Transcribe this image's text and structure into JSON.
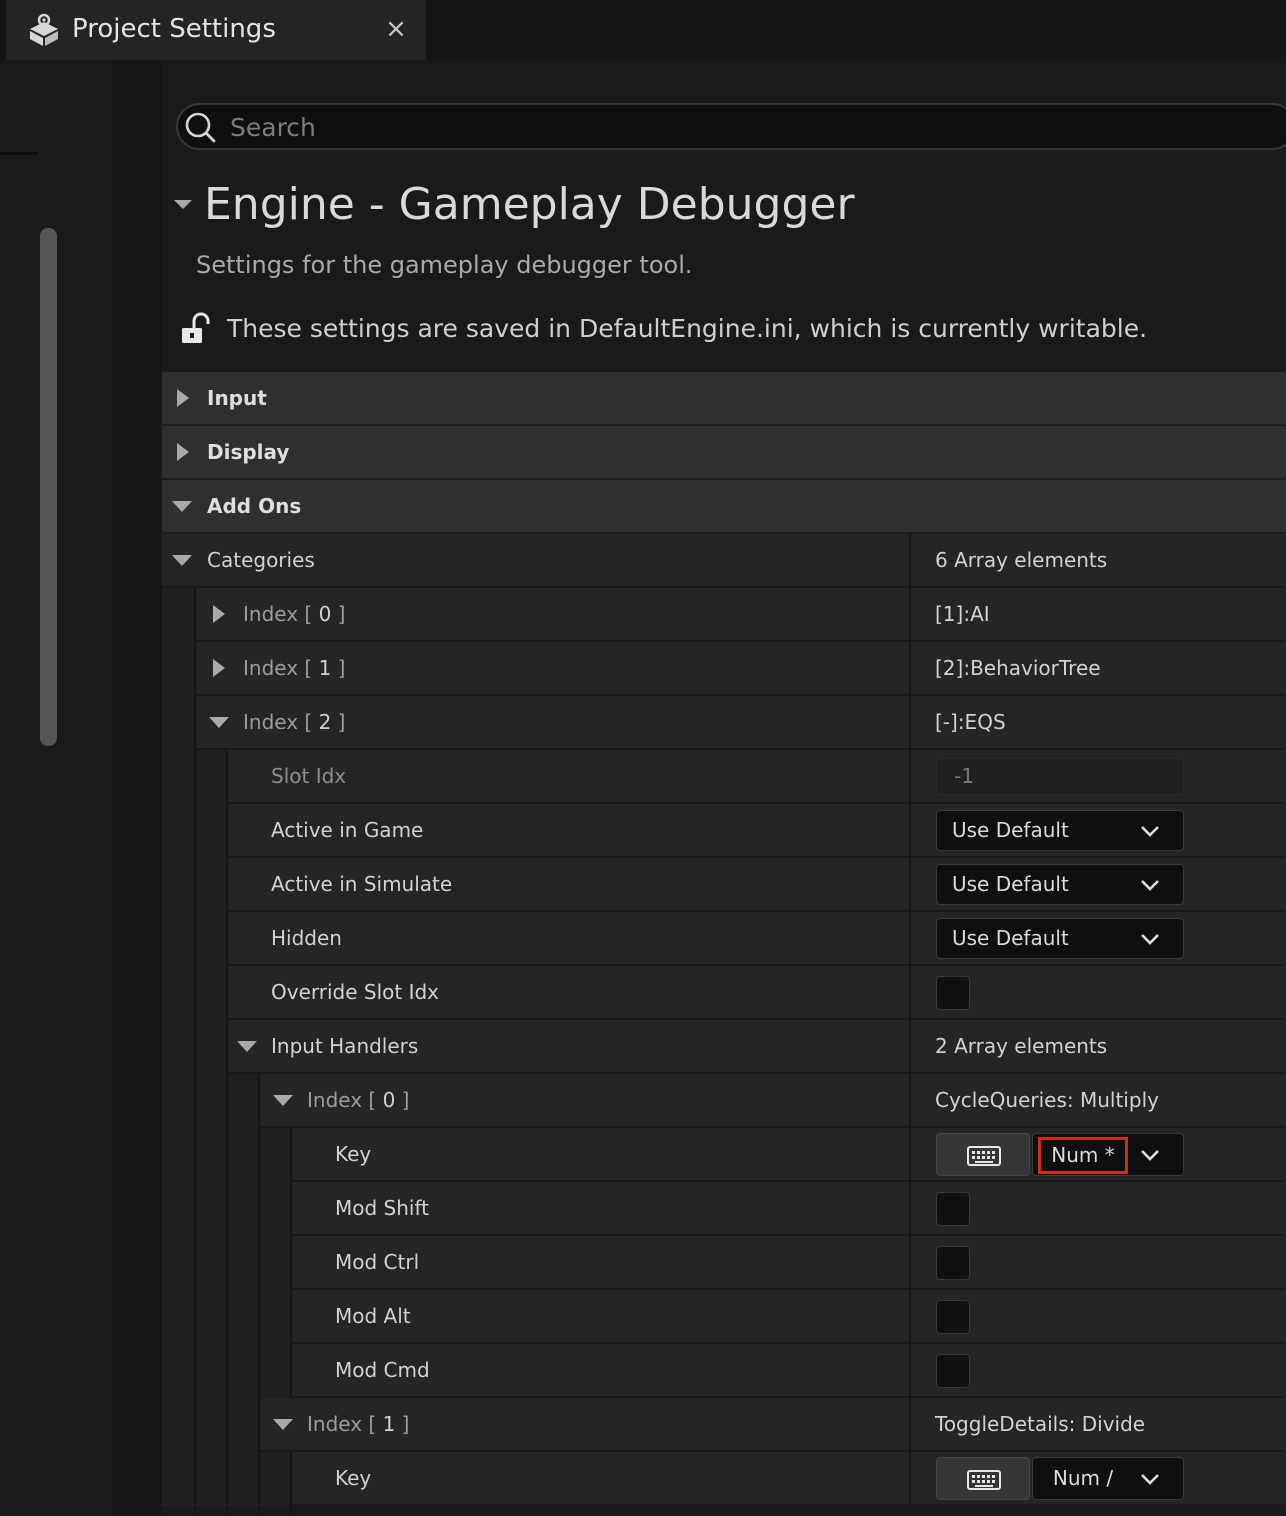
{
  "tab": {
    "title": "Project Settings",
    "close_glyph": "×",
    "icon": "settings-cube-icon"
  },
  "search": {
    "placeholder": "Search",
    "value": ""
  },
  "section": {
    "title": "Engine - Gameplay Debugger",
    "description": "Settings for the gameplay debugger tool.",
    "save_info": "These settings are saved in DefaultEngine.ini, which is currently writable."
  },
  "categories": {
    "input": "Input",
    "display": "Display",
    "addons": "Add Ons"
  },
  "rows": {
    "categories_label": "Categories",
    "categories_value": "6 Array elements",
    "index0_value": "[1]:AI",
    "index1_value": "[2]:BehaviorTree",
    "index2_value": "[-]:EQS",
    "slot_idx_label": "Slot Idx",
    "slot_idx_value": "-1",
    "active_in_game_label": "Active in Game",
    "active_in_game_value": "Use Default",
    "active_in_simulate_label": "Active in Simulate",
    "active_in_simulate_value": "Use Default",
    "hidden_label": "Hidden",
    "hidden_value": "Use Default",
    "override_slot_idx_label": "Override Slot Idx",
    "input_handlers_label": "Input Handlers",
    "input_handlers_value": "2 Array elements",
    "handler0_value": "CycleQueries: Multiply",
    "handler1_value": "ToggleDetails: Divide",
    "key_label": "Key",
    "handler0_key": "Num *",
    "handler1_key": "Num /",
    "mod_shift_label": "Mod Shift",
    "mod_ctrl_label": "Mod Ctrl",
    "mod_alt_label": "Mod Alt",
    "mod_cmd_label": "Mod Cmd"
  },
  "index_labels": {
    "prefix": "Index [",
    "suffix": "]",
    "i0": "0",
    "i1": "1",
    "i2": "2"
  },
  "colors": {
    "key_highlight": "#d12b1b",
    "category_bg": "#2f2f2f",
    "row_bg": "#252525"
  }
}
